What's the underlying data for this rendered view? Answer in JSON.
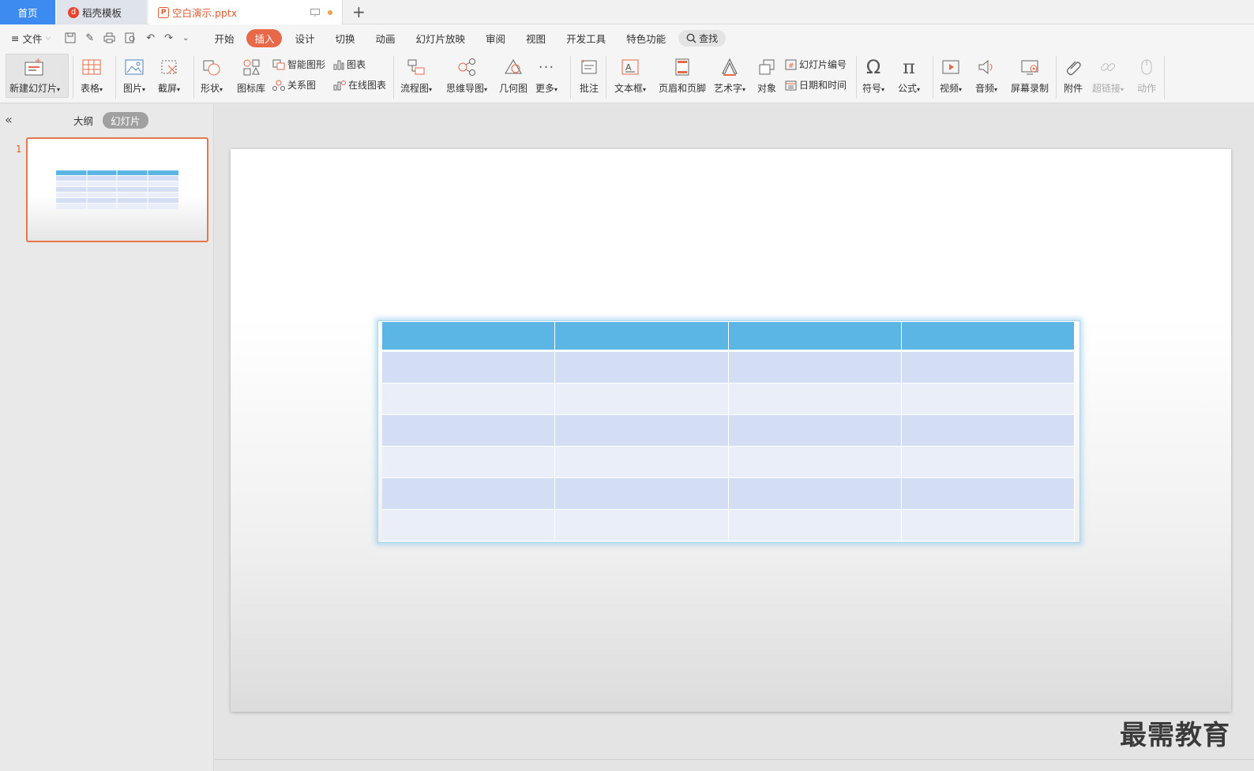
{
  "tabs": {
    "home": "首页",
    "template": "稻壳模板",
    "document": "空白演示.pptx",
    "add": "+"
  },
  "menu": {
    "file": "文件",
    "tabs": [
      "开始",
      "插入",
      "设计",
      "切换",
      "动画",
      "幻灯片放映",
      "审阅",
      "视图",
      "开发工具",
      "特色功能"
    ],
    "active_tab": "插入",
    "search": "查找"
  },
  "ribbon": {
    "new_slide": "新建幻灯片",
    "table": "表格",
    "picture": "图片",
    "screenshot": "截屏",
    "shape": "形状",
    "icon_library": "图标库",
    "smart_shape": "智能图形",
    "chart": "图表",
    "relation": "关系图",
    "online_chart": "在线图表",
    "flowchart": "流程图",
    "mindmap": "思维导图",
    "geometry": "几何图",
    "more": "更多",
    "comment": "批注",
    "textbox": "文本框",
    "header_footer": "页眉和页脚",
    "wordart": "艺术字",
    "object": "对象",
    "slide_number": "幻灯片编号",
    "date_time": "日期和时间",
    "symbol": "符号",
    "formula": "公式",
    "video": "视频",
    "audio": "音频",
    "screen_record": "屏幕录制",
    "attachment": "附件",
    "hyperlink": "超链接",
    "action": "动作"
  },
  "panel": {
    "outline": "大纲",
    "slides": "幻灯片",
    "slide_number": "1"
  },
  "watermark": "最需教育",
  "colors": {
    "accent": "#e8694a",
    "home_tab": "#3d8bf0",
    "table_header": "#5bb6e6",
    "table_band_dark": "#d3ddf4",
    "table_band_light": "#e9eef9"
  }
}
